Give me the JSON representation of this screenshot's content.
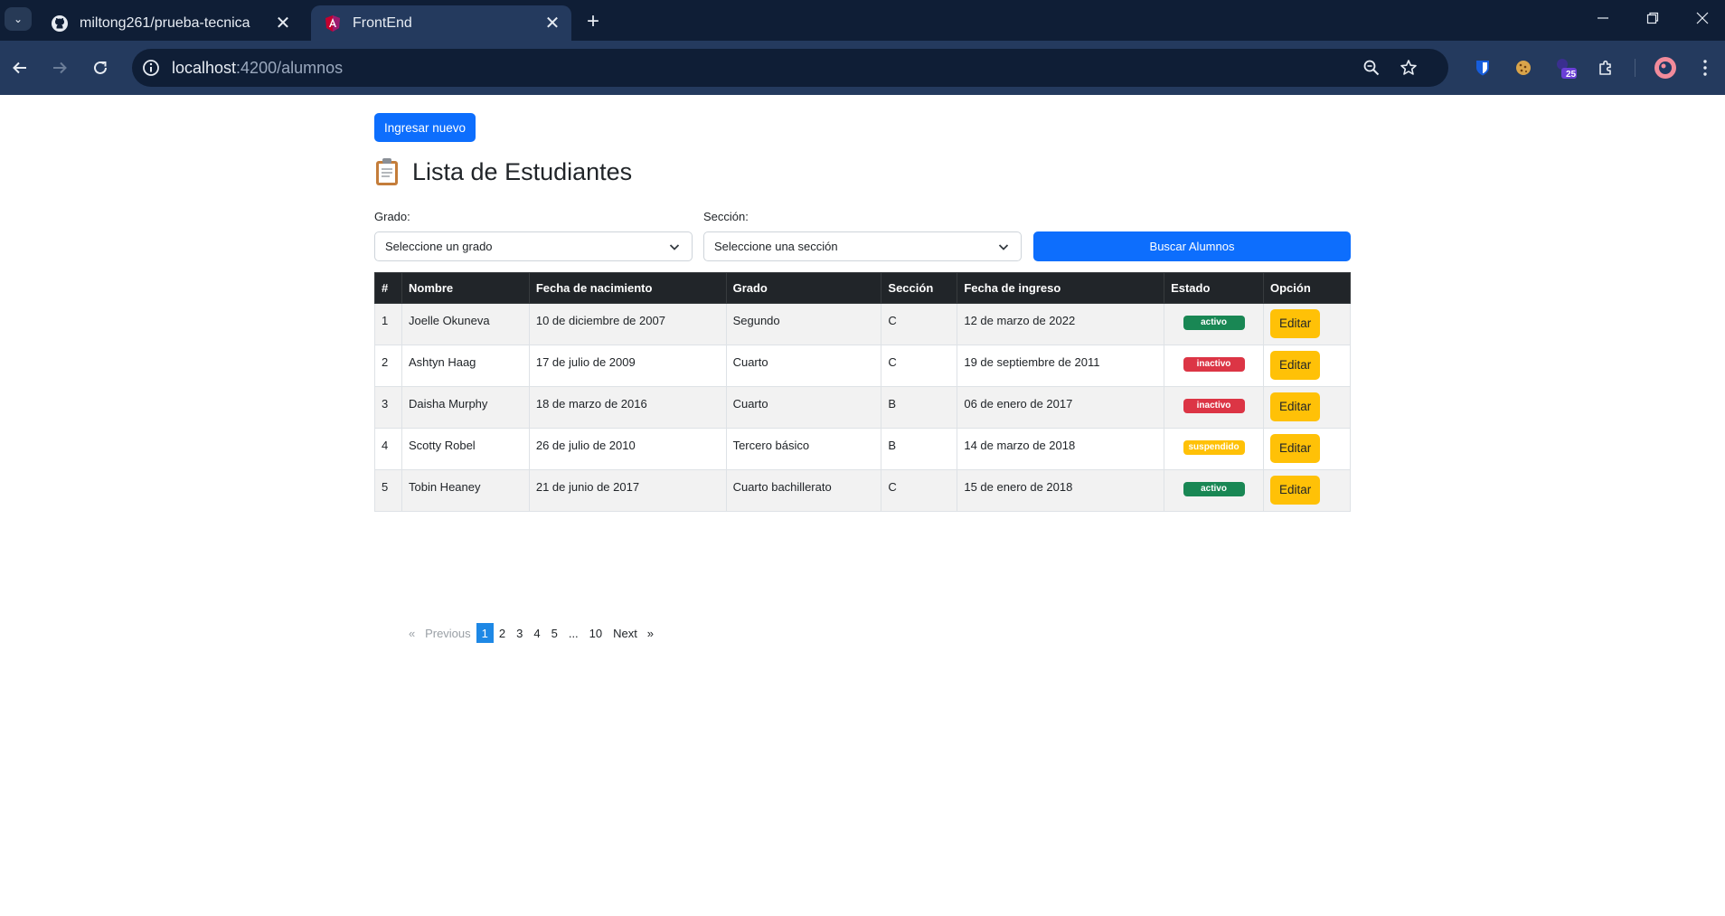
{
  "browser": {
    "tabs": [
      {
        "title": "miltong261/prueba-tecnica",
        "active": false
      },
      {
        "title": "FrontEnd",
        "active": true
      }
    ],
    "new_tab_glyph": "+",
    "close_glyph": "✕",
    "url_host": "localhost",
    "url_path": ":4200/alumnos",
    "extension_badge_count": "25",
    "accent_colors": {
      "frame": "#0f1e36",
      "toolbar": "#243a5e"
    }
  },
  "page": {
    "new_button_label": "Ingresar nuevo",
    "title": "Lista de Estudiantes",
    "title_icon": "clipboard-icon",
    "filters": {
      "grado_label": "Grado:",
      "grado_placeholder": "Seleccione un grado",
      "seccion_label": "Sección:",
      "seccion_placeholder": "Seleccione una sección",
      "search_button_label": "Buscar Alumnos"
    },
    "table": {
      "headers": [
        "#",
        "Nombre",
        "Fecha de nacimiento",
        "Grado",
        "Sección",
        "Fecha de ingreso",
        "Estado",
        "Opción"
      ],
      "rows": [
        {
          "n": "1",
          "nombre": "Joelle Okuneva",
          "nacimiento": "10 de diciembre de 2007",
          "grado": "Segundo",
          "seccion": "C",
          "ingreso": "12 de marzo de 2022",
          "estado": "activo",
          "opcion": "Editar"
        },
        {
          "n": "2",
          "nombre": "Ashtyn Haag",
          "nacimiento": "17 de julio de 2009",
          "grado": "Cuarto",
          "seccion": "C",
          "ingreso": "19 de septiembre de 2011",
          "estado": "inactivo",
          "opcion": "Editar"
        },
        {
          "n": "3",
          "nombre": "Daisha Murphy",
          "nacimiento": "18 de marzo de 2016",
          "grado": "Cuarto",
          "seccion": "B",
          "ingreso": "06 de enero de 2017",
          "estado": "inactivo",
          "opcion": "Editar"
        },
        {
          "n": "4",
          "nombre": "Scotty Robel",
          "nacimiento": "26 de julio de 2010",
          "grado": "Tercero básico",
          "seccion": "B",
          "ingreso": "14 de marzo de 2018",
          "estado": "suspendido",
          "opcion": "Editar"
        },
        {
          "n": "5",
          "nombre": "Tobin Heaney",
          "nacimiento": "21 de junio de 2017",
          "grado": "Cuarto bachillerato",
          "seccion": "C",
          "ingreso": "15 de enero de 2018",
          "estado": "activo",
          "opcion": "Editar"
        }
      ]
    },
    "pagination": {
      "previous": "«   Previous",
      "pages": [
        "1",
        "2",
        "3",
        "4",
        "5",
        "...",
        "10"
      ],
      "current": "1",
      "next": "Next   »"
    },
    "colors": {
      "primary": "#0d6efd",
      "warning": "#ffc107",
      "success": "#198754",
      "danger": "#dc3545",
      "table_header": "#212529"
    }
  }
}
